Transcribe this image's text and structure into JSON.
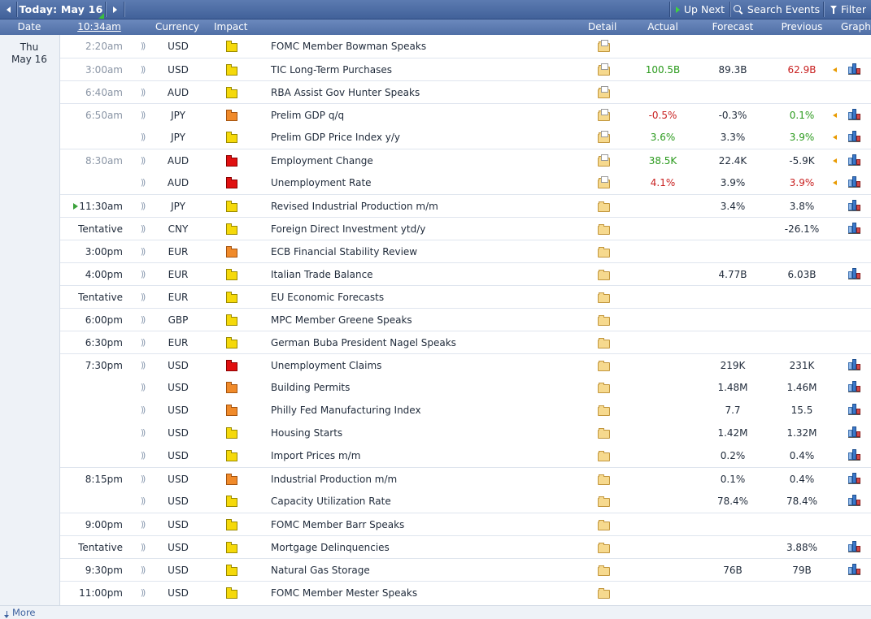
{
  "toolbar": {
    "today_label": "Today: May 16",
    "up_next": "Up Next",
    "search_events": "Search Events",
    "filter": "Filter"
  },
  "header": {
    "date": "Date",
    "time": "10:34am",
    "currency": "Currency",
    "impact": "Impact",
    "detail": "Detail",
    "actual": "Actual",
    "forecast": "Forecast",
    "previous": "Previous",
    "graph": "Graph"
  },
  "date_group": {
    "weekday": "Thu",
    "date": "May 16"
  },
  "rows": [
    {
      "time": "2:20am",
      "past": true,
      "currency": "USD",
      "impact": "yellow",
      "event": "FOMC Member Bowman Speaks",
      "detail_rich": true,
      "actual": "",
      "actual_color": "",
      "forecast": "",
      "previous": "",
      "previous_color": "",
      "revised": false,
      "graph": false,
      "border": false
    },
    {
      "time": "3:00am",
      "past": true,
      "currency": "USD",
      "impact": "yellow",
      "event": "TIC Long-Term Purchases",
      "detail_rich": true,
      "actual": "100.5B",
      "actual_color": "green",
      "forecast": "89.3B",
      "previous": "62.9B",
      "previous_color": "red",
      "revised": true,
      "graph": true,
      "border": true
    },
    {
      "time": "6:40am",
      "past": true,
      "currency": "AUD",
      "impact": "yellow",
      "event": "RBA Assist Gov Hunter Speaks",
      "detail_rich": true,
      "actual": "",
      "actual_color": "",
      "forecast": "",
      "previous": "",
      "previous_color": "",
      "revised": false,
      "graph": false,
      "border": true
    },
    {
      "time": "6:50am",
      "past": true,
      "currency": "JPY",
      "impact": "orange",
      "event": "Prelim GDP q/q",
      "detail_rich": true,
      "actual": "-0.5%",
      "actual_color": "red",
      "forecast": "-0.3%",
      "previous": "0.1%",
      "previous_color": "green",
      "revised": true,
      "graph": true,
      "border": true
    },
    {
      "time": "",
      "past": true,
      "currency": "JPY",
      "impact": "yellow",
      "event": "Prelim GDP Price Index y/y",
      "detail_rich": true,
      "actual": "3.6%",
      "actual_color": "green",
      "forecast": "3.3%",
      "previous": "3.9%",
      "previous_color": "green",
      "revised": true,
      "graph": true,
      "border": false
    },
    {
      "time": "8:30am",
      "past": true,
      "currency": "AUD",
      "impact": "red",
      "event": "Employment Change",
      "detail_rich": true,
      "actual": "38.5K",
      "actual_color": "green",
      "forecast": "22.4K",
      "previous": "-5.9K",
      "previous_color": "",
      "revised": true,
      "graph": true,
      "border": true
    },
    {
      "time": "",
      "past": true,
      "currency": "AUD",
      "impact": "red",
      "event": "Unemployment Rate",
      "detail_rich": true,
      "actual": "4.1%",
      "actual_color": "red",
      "forecast": "3.9%",
      "previous": "3.9%",
      "previous_color": "red",
      "revised": true,
      "graph": true,
      "border": false
    },
    {
      "time": "11:30am",
      "past": false,
      "now": true,
      "currency": "JPY",
      "impact": "yellow",
      "event": "Revised Industrial Production m/m",
      "detail_rich": false,
      "actual": "",
      "actual_color": "",
      "forecast": "3.4%",
      "previous": "3.8%",
      "previous_color": "",
      "revised": false,
      "graph": true,
      "border": true
    },
    {
      "time": "Tentative",
      "past": false,
      "currency": "CNY",
      "impact": "yellow",
      "event": "Foreign Direct Investment ytd/y",
      "detail_rich": false,
      "actual": "",
      "actual_color": "",
      "forecast": "",
      "previous": "-26.1%",
      "previous_color": "",
      "revised": false,
      "graph": true,
      "border": true
    },
    {
      "time": "3:00pm",
      "past": false,
      "currency": "EUR",
      "impact": "orange",
      "event": "ECB Financial Stability Review",
      "detail_rich": false,
      "actual": "",
      "actual_color": "",
      "forecast": "",
      "previous": "",
      "previous_color": "",
      "revised": false,
      "graph": false,
      "border": true
    },
    {
      "time": "4:00pm",
      "past": false,
      "currency": "EUR",
      "impact": "yellow",
      "event": "Italian Trade Balance",
      "detail_rich": false,
      "actual": "",
      "actual_color": "",
      "forecast": "4.77B",
      "previous": "6.03B",
      "previous_color": "",
      "revised": false,
      "graph": true,
      "border": true
    },
    {
      "time": "Tentative",
      "past": false,
      "currency": "EUR",
      "impact": "yellow",
      "event": "EU Economic Forecasts",
      "detail_rich": false,
      "actual": "",
      "actual_color": "",
      "forecast": "",
      "previous": "",
      "previous_color": "",
      "revised": false,
      "graph": false,
      "border": true
    },
    {
      "time": "6:00pm",
      "past": false,
      "currency": "GBP",
      "impact": "yellow",
      "event": "MPC Member Greene Speaks",
      "detail_rich": false,
      "actual": "",
      "actual_color": "",
      "forecast": "",
      "previous": "",
      "previous_color": "",
      "revised": false,
      "graph": false,
      "border": true
    },
    {
      "time": "6:30pm",
      "past": false,
      "currency": "EUR",
      "impact": "yellow",
      "event": "German Buba President Nagel Speaks",
      "detail_rich": false,
      "actual": "",
      "actual_color": "",
      "forecast": "",
      "previous": "",
      "previous_color": "",
      "revised": false,
      "graph": false,
      "border": true
    },
    {
      "time": "7:30pm",
      "past": false,
      "currency": "USD",
      "impact": "red",
      "event": "Unemployment Claims",
      "detail_rich": false,
      "actual": "",
      "actual_color": "",
      "forecast": "219K",
      "previous": "231K",
      "previous_color": "",
      "revised": false,
      "graph": true,
      "border": true
    },
    {
      "time": "",
      "past": false,
      "currency": "USD",
      "impact": "orange",
      "event": "Building Permits",
      "detail_rich": false,
      "actual": "",
      "actual_color": "",
      "forecast": "1.48M",
      "previous": "1.46M",
      "previous_color": "",
      "revised": false,
      "graph": true,
      "border": false
    },
    {
      "time": "",
      "past": false,
      "currency": "USD",
      "impact": "orange",
      "event": "Philly Fed Manufacturing Index",
      "detail_rich": false,
      "actual": "",
      "actual_color": "",
      "forecast": "7.7",
      "previous": "15.5",
      "previous_color": "",
      "revised": false,
      "graph": true,
      "border": false
    },
    {
      "time": "",
      "past": false,
      "currency": "USD",
      "impact": "yellow",
      "event": "Housing Starts",
      "detail_rich": false,
      "actual": "",
      "actual_color": "",
      "forecast": "1.42M",
      "previous": "1.32M",
      "previous_color": "",
      "revised": false,
      "graph": true,
      "border": false
    },
    {
      "time": "",
      "past": false,
      "currency": "USD",
      "impact": "yellow",
      "event": "Import Prices m/m",
      "detail_rich": false,
      "actual": "",
      "actual_color": "",
      "forecast": "0.2%",
      "previous": "0.4%",
      "previous_color": "",
      "revised": false,
      "graph": true,
      "border": false
    },
    {
      "time": "8:15pm",
      "past": false,
      "currency": "USD",
      "impact": "orange",
      "event": "Industrial Production m/m",
      "detail_rich": false,
      "actual": "",
      "actual_color": "",
      "forecast": "0.1%",
      "previous": "0.4%",
      "previous_color": "",
      "revised": false,
      "graph": true,
      "border": true
    },
    {
      "time": "",
      "past": false,
      "currency": "USD",
      "impact": "yellow",
      "event": "Capacity Utilization Rate",
      "detail_rich": false,
      "actual": "",
      "actual_color": "",
      "forecast": "78.4%",
      "previous": "78.4%",
      "previous_color": "",
      "revised": false,
      "graph": true,
      "border": false
    },
    {
      "time": "9:00pm",
      "past": false,
      "currency": "USD",
      "impact": "yellow",
      "event": "FOMC Member Barr Speaks",
      "detail_rich": false,
      "actual": "",
      "actual_color": "",
      "forecast": "",
      "previous": "",
      "previous_color": "",
      "revised": false,
      "graph": false,
      "border": true
    },
    {
      "time": "Tentative",
      "past": false,
      "currency": "USD",
      "impact": "yellow",
      "event": "Mortgage Delinquencies",
      "detail_rich": false,
      "actual": "",
      "actual_color": "",
      "forecast": "",
      "previous": "3.88%",
      "previous_color": "",
      "revised": false,
      "graph": true,
      "border": true
    },
    {
      "time": "9:30pm",
      "past": false,
      "currency": "USD",
      "impact": "yellow",
      "event": "Natural Gas Storage",
      "detail_rich": false,
      "actual": "",
      "actual_color": "",
      "forecast": "76B",
      "previous": "79B",
      "previous_color": "",
      "revised": false,
      "graph": true,
      "border": true
    },
    {
      "time": "11:00pm",
      "past": false,
      "currency": "USD",
      "impact": "yellow",
      "event": "FOMC Member Mester Speaks",
      "detail_rich": false,
      "actual": "",
      "actual_color": "",
      "forecast": "",
      "previous": "",
      "previous_color": "",
      "revised": false,
      "graph": false,
      "border": true
    }
  ],
  "footer": {
    "more": "More"
  },
  "colors": {
    "toolbar": "#4a6aa3",
    "header": "#5d7cb2",
    "green": "#2a9a1c",
    "red": "#c82020"
  },
  "icons": {
    "impact": "folder-icon",
    "detail": "detail-folder-icon",
    "graph": "bar-chart-icon"
  }
}
